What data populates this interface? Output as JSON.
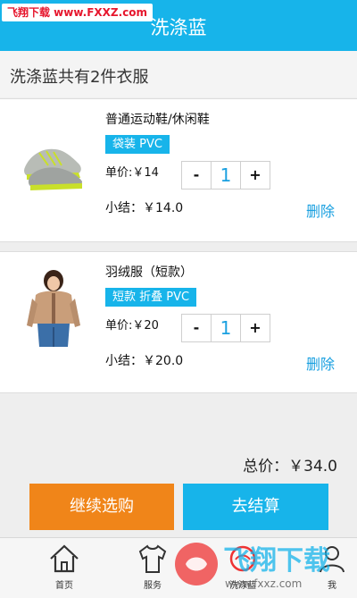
{
  "header": {
    "title": "洗涤蓝",
    "watermark": "飞翔下载 www.FXXZ.com"
  },
  "cart_summary": "洗涤蓝共有2件衣服",
  "items": [
    {
      "name": "普通运动鞋/休闲鞋",
      "tags": "袋装 PVC",
      "unit_price": "单价:￥14",
      "quantity": "1",
      "subtotal": "小结：￥14.0",
      "delete_label": "删除",
      "minus": "-",
      "plus": "+"
    },
    {
      "name": "羽绒服（短款）",
      "tags": "短款 折叠 PVC",
      "unit_price": "单价:￥20",
      "quantity": "1",
      "subtotal": "小结：￥20.0",
      "delete_label": "删除",
      "minus": "-",
      "plus": "+"
    }
  ],
  "total": "总价：￥34.0",
  "buttons": {
    "continue": "继续选购",
    "checkout": "去结算"
  },
  "tabs": [
    {
      "label": "首页",
      "icon": "home-icon"
    },
    {
      "label": "服务",
      "icon": "shirt-icon"
    },
    {
      "label": "洗涤蓝",
      "icon": "laundry-icon"
    },
    {
      "label": "我",
      "icon": "user-icon"
    }
  ],
  "watermark_logo": {
    "text": "飞翔下载",
    "url": "www.fxxz.com"
  },
  "colors": {
    "primary": "#17b4ea",
    "accent": "#f08519",
    "link": "#1aa0e0"
  }
}
